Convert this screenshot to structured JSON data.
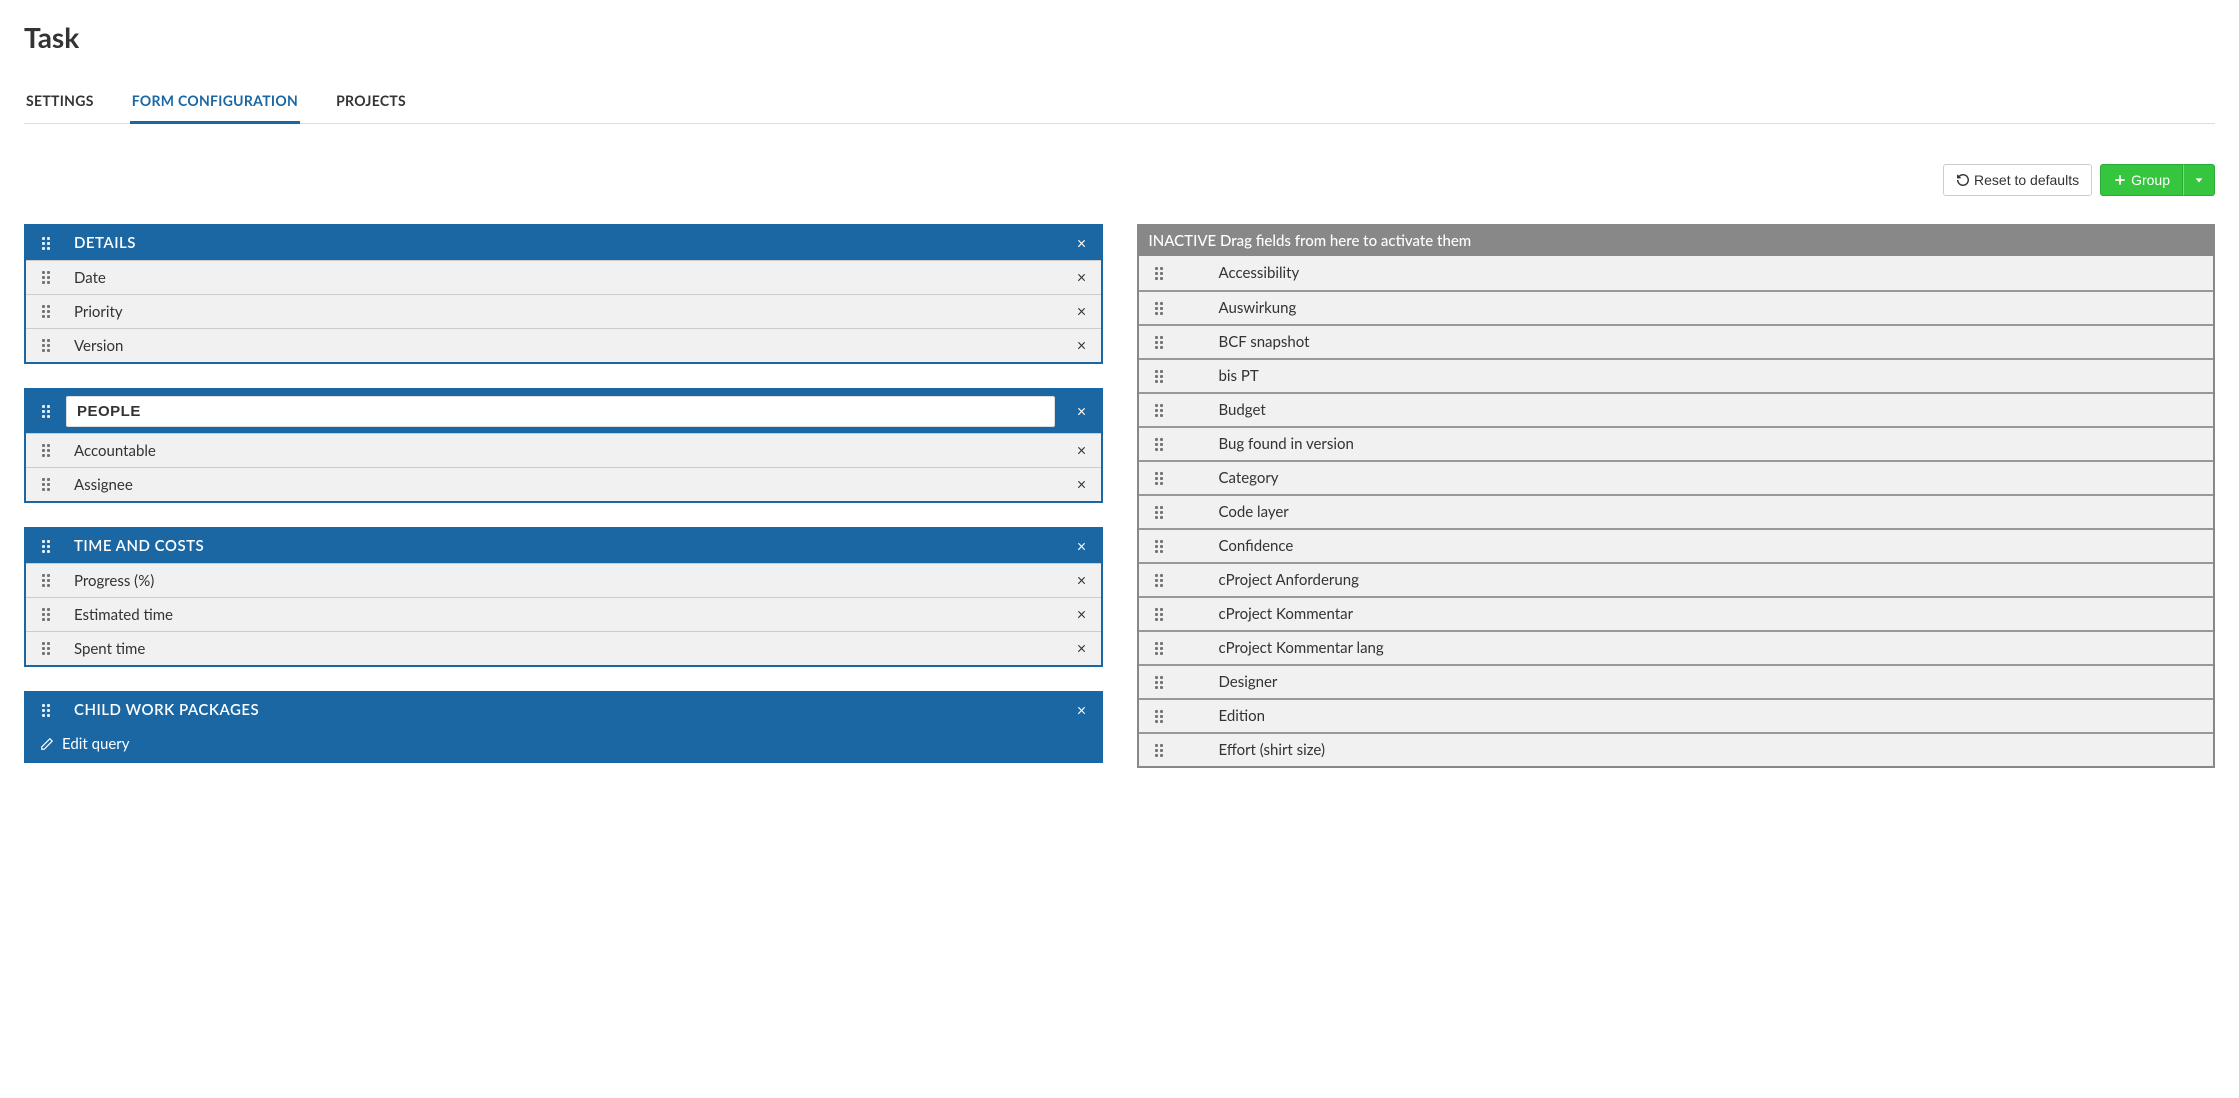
{
  "page_title": "Task",
  "tabs": [
    {
      "label": "SETTINGS",
      "active": false
    },
    {
      "label": "FORM CONFIGURATION",
      "active": true
    },
    {
      "label": "PROJECTS",
      "active": false
    }
  ],
  "toolbar": {
    "reset_label": "Reset to defaults",
    "group_label": "Group"
  },
  "groups": [
    {
      "key": "details",
      "title": "DETAILS",
      "editing": false,
      "fields": [
        "Date",
        "Priority",
        "Version"
      ]
    },
    {
      "key": "people",
      "title": "PEOPLE",
      "editing": true,
      "fields": [
        "Accountable",
        "Assignee"
      ]
    },
    {
      "key": "time_costs",
      "title": "TIME AND COSTS",
      "editing": false,
      "fields": [
        "Progress (%)",
        "Estimated time",
        "Spent time"
      ]
    },
    {
      "key": "child_work_packages",
      "title": "CHILD WORK PACKAGES",
      "editing": false,
      "fields": [],
      "edit_query_label": "Edit query"
    }
  ],
  "inactive": {
    "header": "INACTIVE Drag fields from here to activate them",
    "fields": [
      "Accessibility",
      "Auswirkung",
      "BCF snapshot",
      "bis PT",
      "Budget",
      "Bug found in version",
      "Category",
      "Code layer",
      "Confidence",
      "cProject Anforderung",
      "cProject Kommentar",
      "cProject Kommentar lang",
      "Designer",
      "Edition",
      "Effort (shirt size)"
    ]
  }
}
